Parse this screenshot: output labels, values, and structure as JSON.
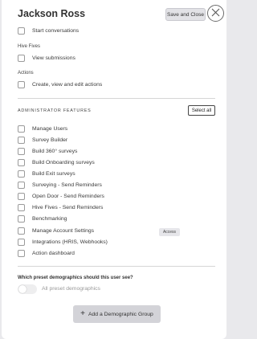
{
  "header": {
    "title": "Jackson Ross",
    "save_label": "Save and Close"
  },
  "top_permissions": {
    "conversations_item": "Start conversations",
    "hive_fives_label": "Hive Fives",
    "hive_fives_item": "View submissions",
    "actions_label": "Actions",
    "actions_item": "Create, view and edit actions"
  },
  "admin": {
    "heading": "ADMINISTRATOR FEATURES",
    "select_all": "Select all",
    "items": [
      "Manage Users",
      "Survey Builder",
      "Build 360° surveys",
      "Build Onboarding surveys",
      "Build Exit surveys",
      "Surveying - Send Reminders",
      "Open Door - Send Reminders",
      "Hive Fives - Send Reminders",
      "Benchmarking",
      "Manage Account Settings",
      "Integrations (HRIS, Webhooks)",
      "Action dashboard"
    ],
    "tooltip": "Access"
  },
  "demographics": {
    "question": "Which preset demographics should this user see?",
    "toggle_label": "All preset demographics",
    "add_button": "Add a Demographic Group"
  }
}
